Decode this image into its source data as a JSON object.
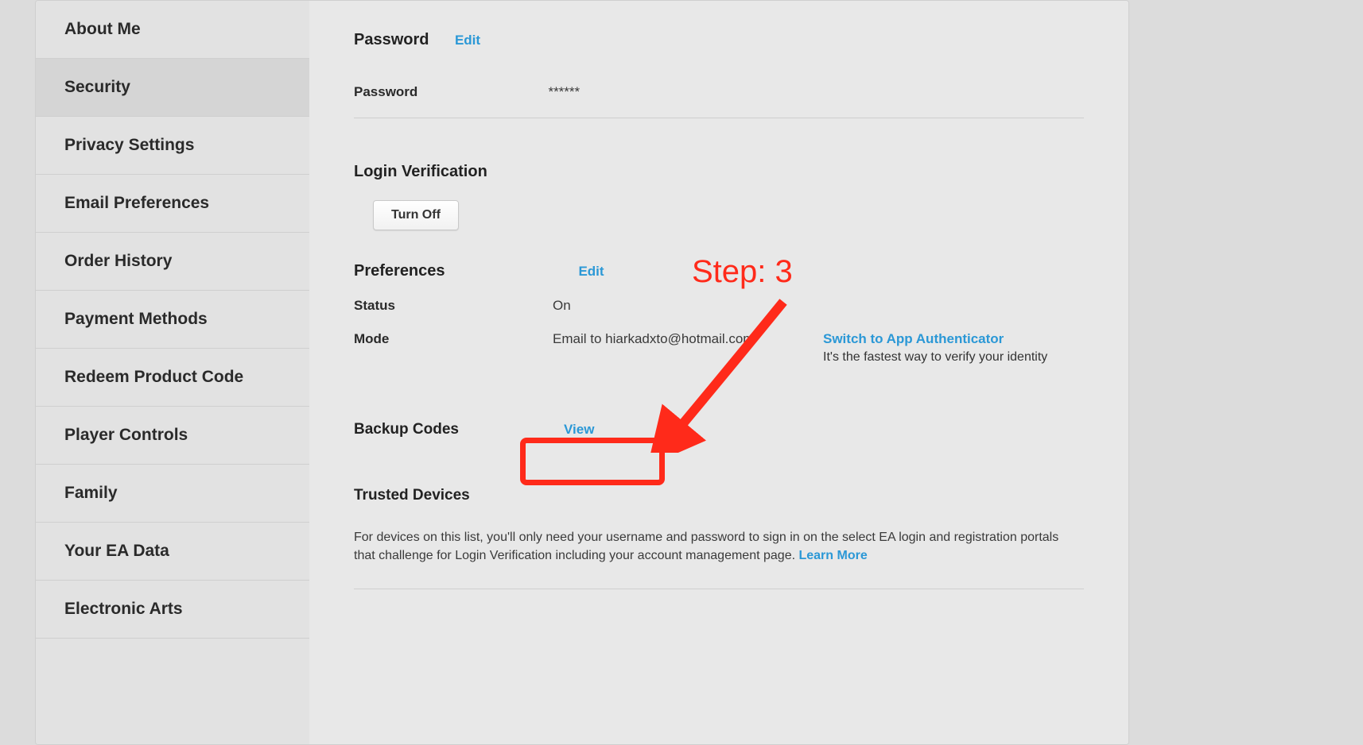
{
  "sidebar": {
    "items": [
      {
        "label": "About Me"
      },
      {
        "label": "Security"
      },
      {
        "label": "Privacy Settings"
      },
      {
        "label": "Email Preferences"
      },
      {
        "label": "Order History"
      },
      {
        "label": "Payment Methods"
      },
      {
        "label": "Redeem Product Code"
      },
      {
        "label": "Player Controls"
      },
      {
        "label": "Family"
      },
      {
        "label": "Your EA Data"
      },
      {
        "label": "Electronic Arts"
      }
    ],
    "activeIndex": 1
  },
  "password_section": {
    "heading": "Password",
    "edit": "Edit",
    "label": "Password",
    "value": "******"
  },
  "login_verification": {
    "heading": "Login Verification",
    "turn_off": "Turn Off",
    "preferences_heading": "Preferences",
    "preferences_edit": "Edit",
    "status_label": "Status",
    "status_value": "On",
    "mode_label": "Mode",
    "mode_value": "Email to hiarkadxto@hotmail.com",
    "switch_link": "Switch to App Authenticator",
    "switch_sub": "It's the fastest way to verify your identity"
  },
  "backup_codes": {
    "heading": "Backup Codes",
    "view": "View"
  },
  "trusted_devices": {
    "heading": "Trusted Devices",
    "text": "For devices on this list, you'll only need your username and password to sign in on the select EA login and registration portals that challenge for Login Verification including your account management page.  ",
    "learn_more": "Learn More"
  },
  "annotation": {
    "step_label": "Step: 3"
  }
}
